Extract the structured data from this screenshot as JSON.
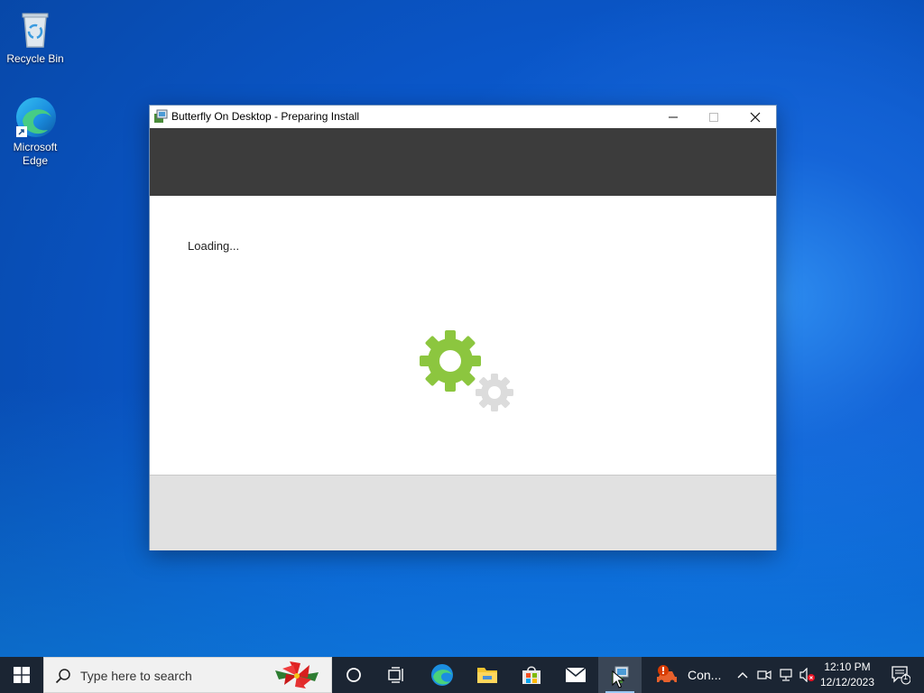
{
  "desktop": {
    "icons": [
      {
        "label": "Recycle Bin",
        "icon": "recycle-bin-icon"
      },
      {
        "label": "Microsoft Edge",
        "icon": "edge-icon"
      }
    ]
  },
  "window": {
    "title": "Butterfly On Desktop - Preparing Install",
    "status": "Loading...",
    "controls": {
      "minimize": "minimize-icon",
      "maximize": "maximize-icon",
      "close": "close-icon"
    }
  },
  "taskbar": {
    "search_placeholder": "Type here to search",
    "running_app_label": "Con...",
    "clock_time": "12:10 PM",
    "clock_date": "12/12/2023",
    "notification_count": "1"
  },
  "colors": {
    "header_band": "#3c3c3c",
    "footer_band": "#e1e1e1",
    "gear_green": "#8cc63f",
    "gear_gray": "#d9d9d9",
    "taskbar": "#1b2533"
  }
}
